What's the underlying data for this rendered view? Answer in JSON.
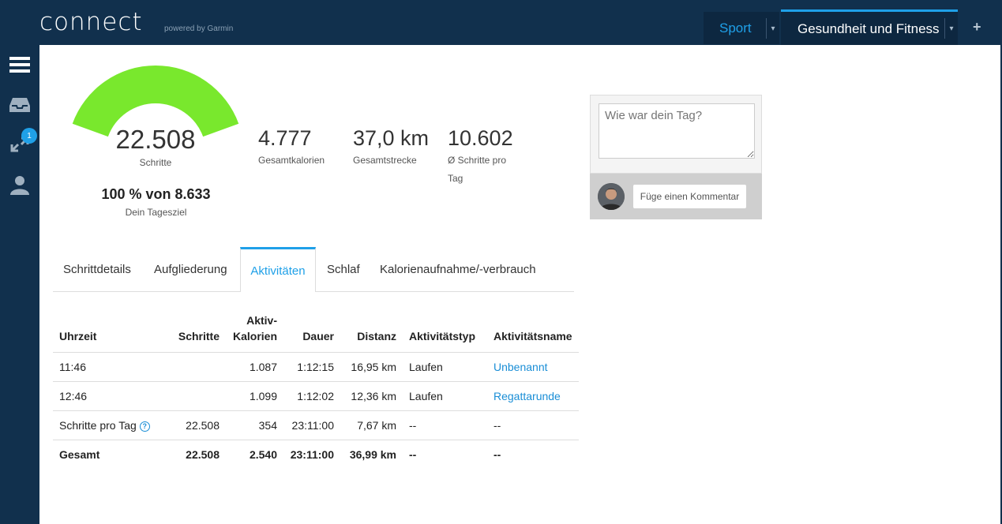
{
  "header": {
    "logo": "connect",
    "powered_by": "powered by Garmin",
    "tabs": [
      {
        "label": "Sport"
      },
      {
        "label": "Gesundheit und Fitness"
      }
    ],
    "add_label": "+"
  },
  "sidebar": {
    "items": [
      {
        "icon": "menu-icon"
      },
      {
        "icon": "inbox-icon"
      },
      {
        "icon": "connections-icon",
        "badge": "1"
      },
      {
        "icon": "user-icon"
      }
    ]
  },
  "summary": {
    "steps": "22.508",
    "steps_label": "Schritte",
    "goal_percent": 100,
    "goal_text": "100 % von 8.633",
    "goal_label": "Dein Tagesziel",
    "stats": [
      {
        "value": "4.777",
        "label": "Gesamtkalorien"
      },
      {
        "value": "37,0 km",
        "label": "Gesamtstrecke"
      },
      {
        "value": "10.602",
        "label": "Ø Schritte pro Tag"
      }
    ]
  },
  "tabs": [
    {
      "label": "Schrittdetails"
    },
    {
      "label": "Aufgliederung"
    },
    {
      "label": "Aktivitäten"
    },
    {
      "label": "Schlaf"
    },
    {
      "label": "Kalorienaufnahme/-verbrauch"
    }
  ],
  "table": {
    "headers": [
      "Uhrzeit",
      "Schritte",
      "Aktiv-\nKalorien",
      "Dauer",
      "Distanz",
      "Aktivitätstyp",
      "Aktivitätsname"
    ],
    "rows": [
      [
        "11:46",
        "",
        "1.087",
        "1:12:15",
        "16,95 km",
        "Laufen",
        "Unbenannt"
      ],
      [
        "12:46",
        "",
        "1.099",
        "1:12:02",
        "12,36 km",
        "Laufen",
        "Regattarunde"
      ],
      [
        "Schritte pro Tag",
        "22.508",
        "354",
        "23:11:00",
        "7,67 km",
        "--",
        "--"
      ],
      [
        "Gesamt",
        "22.508",
        "2.540",
        "23:11:00",
        "36,99 km",
        "--",
        "--"
      ]
    ]
  },
  "comment": {
    "placeholder": "Wie war dein Tag?",
    "button": "Füge einen Kommentar"
  },
  "colors": {
    "nav": "#11304d",
    "accent": "#1fa0e8",
    "gauge": "#79e82d"
  }
}
